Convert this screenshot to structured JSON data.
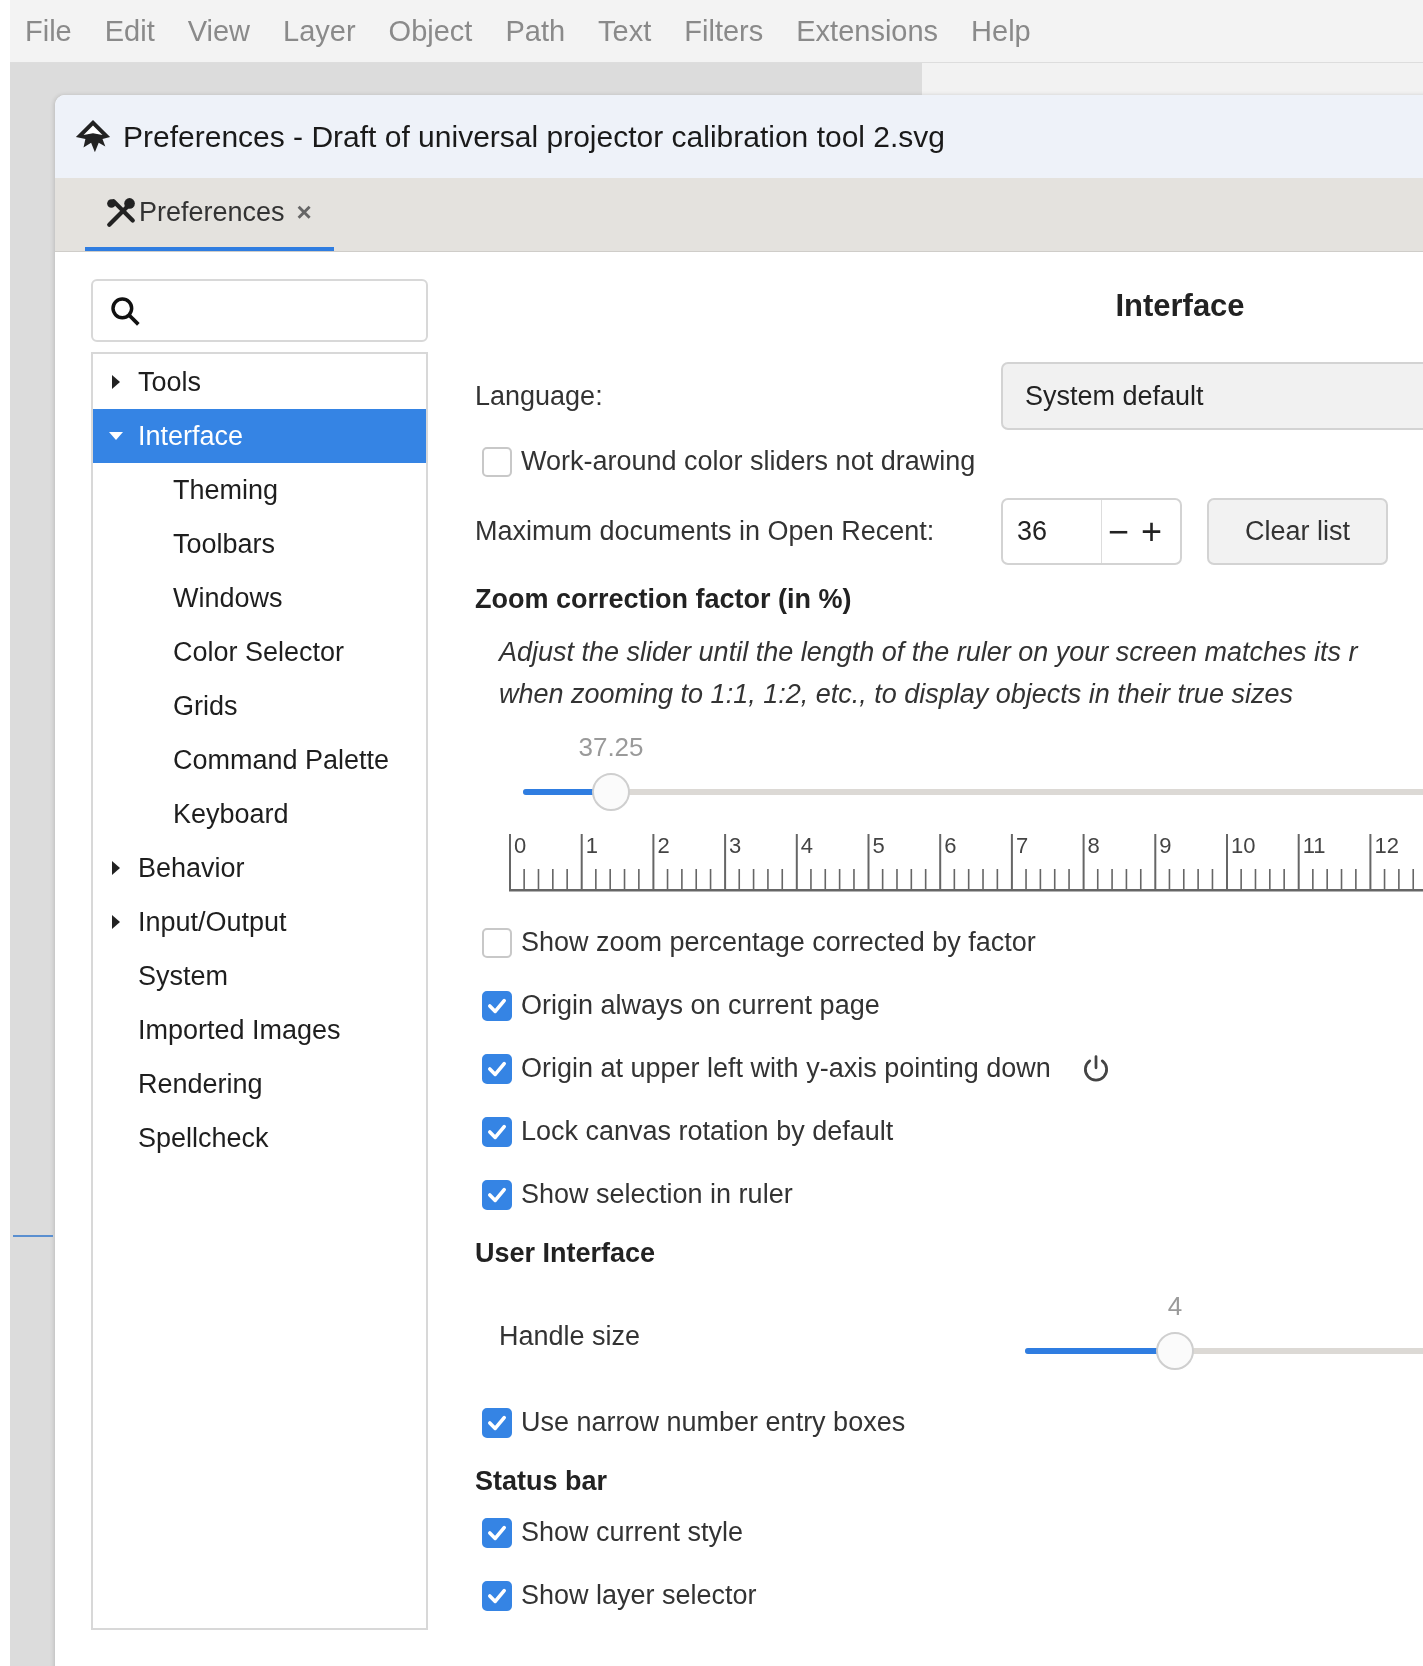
{
  "menu": [
    "File",
    "Edit",
    "View",
    "Layer",
    "Object",
    "Path",
    "Text",
    "Filters",
    "Extensions",
    "Help"
  ],
  "window": {
    "title": "Preferences - Draft of universal projector calibration tool 2.svg"
  },
  "tabs": [
    {
      "label": "Preferences",
      "selected": true,
      "close": "×"
    }
  ],
  "sidebar": {
    "items": [
      {
        "label": "Tools",
        "kind": "folder",
        "expanded": false,
        "selected": false
      },
      {
        "label": "Interface",
        "kind": "folder",
        "expanded": true,
        "selected": true,
        "children": [
          {
            "label": "Theming",
            "kind": "leaf",
            "selected": false
          },
          {
            "label": "Toolbars",
            "kind": "leaf",
            "selected": false
          },
          {
            "label": "Windows",
            "kind": "leaf",
            "selected": false
          },
          {
            "label": "Color Selector",
            "kind": "leaf",
            "selected": false
          },
          {
            "label": "Grids",
            "kind": "leaf",
            "selected": false
          },
          {
            "label": "Command Palette",
            "kind": "leaf",
            "selected": false
          },
          {
            "label": "Keyboard",
            "kind": "leaf",
            "selected": false
          }
        ]
      },
      {
        "label": "Behavior",
        "kind": "folder",
        "expanded": false,
        "selected": false
      },
      {
        "label": "Input/Output",
        "kind": "folder",
        "expanded": false,
        "selected": false
      },
      {
        "label": "System",
        "kind": "leaf",
        "selected": false
      },
      {
        "label": "Imported Images",
        "kind": "leaf",
        "selected": false
      },
      {
        "label": "Rendering",
        "kind": "leaf",
        "selected": false
      },
      {
        "label": "Spellcheck",
        "kind": "leaf",
        "selected": false
      }
    ]
  },
  "panel": {
    "title": "Interface",
    "rows": [
      {
        "kind": "dropdown",
        "label": "Language:",
        "value": "System default"
      },
      {
        "kind": "checkbox",
        "label": "Work-around color sliders not drawing",
        "checked": false,
        "reset": false
      },
      {
        "kind": "spin",
        "label": "Maximum documents in Open Recent:",
        "value": "36",
        "decrement": "−",
        "increment": "+",
        "button": "Clear list"
      },
      {
        "kind": "heading",
        "label": "Zoom correction factor (in %)"
      },
      {
        "kind": "note",
        "text": "Adjust the slider until the length of the ruler on your screen matches its r\nwhen zooming to 1:1, 1:2, etc., to display objects in their true sizes"
      },
      {
        "kind": "slider",
        "value": "37.25",
        "level": 0.08
      },
      {
        "kind": "ruler",
        "labels": [
          "0",
          "1",
          "2",
          "3",
          "4",
          "5",
          "6",
          "7",
          "8",
          "9",
          "10",
          "11",
          "12"
        ]
      },
      {
        "kind": "checkbox",
        "label": "Show zoom percentage corrected by factor",
        "checked": false,
        "reset": false
      },
      {
        "kind": "checkbox",
        "label": "Origin always on current page",
        "checked": true,
        "reset": false
      },
      {
        "kind": "checkbox",
        "label": "Origin at upper left with y-axis pointing down",
        "checked": true,
        "reset": true
      },
      {
        "kind": "checkbox",
        "label": "Lock canvas rotation by default",
        "checked": true,
        "reset": false
      },
      {
        "kind": "checkbox",
        "label": "Show selection in ruler",
        "checked": true,
        "reset": false
      },
      {
        "kind": "heading",
        "label": "User Interface"
      },
      {
        "kind": "labeled_slider",
        "label": "Handle size",
        "value": "4",
        "level": 0.25
      },
      {
        "kind": "checkbox",
        "label": "Use narrow number entry boxes",
        "checked": true,
        "reset": false
      },
      {
        "kind": "heading",
        "label": "Status bar"
      },
      {
        "kind": "checkbox",
        "label": "Show current style",
        "checked": true,
        "reset": false
      },
      {
        "kind": "checkbox",
        "label": "Show layer selector",
        "checked": true,
        "reset": false
      }
    ]
  }
}
